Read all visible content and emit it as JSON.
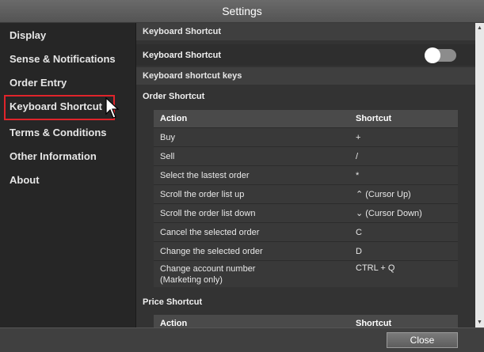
{
  "window": {
    "title": "Settings"
  },
  "sidebar": {
    "items": [
      {
        "label": "Display"
      },
      {
        "label": "Sense & Notifications"
      },
      {
        "label": "Order Entry"
      },
      {
        "label": "Keyboard Shortcut",
        "selected": true
      },
      {
        "label": "Terms & Conditions"
      },
      {
        "label": "Other Information"
      },
      {
        "label": "About"
      }
    ]
  },
  "content": {
    "section_header": "Keyboard Shortcut",
    "toggle_label": "Keyboard Shortcut",
    "toggle_state": "on",
    "keys_header": "Keyboard shortcut keys",
    "order_title": "Order Shortcut",
    "order_table": {
      "headers": [
        "Action",
        "Shortcut"
      ],
      "rows": [
        [
          "Buy",
          "+"
        ],
        [
          "Sell",
          "/"
        ],
        [
          "Select the lastest order",
          "*"
        ],
        [
          "Scroll the order list up",
          "⌃ (Cursor Up)"
        ],
        [
          "Scroll the order list down",
          "⌄ (Cursor Down)"
        ],
        [
          "Cancel the selected order",
          "C"
        ],
        [
          "Change the selected order",
          "D"
        ],
        [
          "Change account number\n(Marketing only)",
          "CTRL + Q"
        ]
      ]
    },
    "price_title": "Price Shortcut",
    "price_table": {
      "headers": [
        "Action",
        "Shortcut"
      ]
    }
  },
  "footer": {
    "close_label": "Close"
  },
  "colors": {
    "highlight": "#e0242b",
    "background": "#333333",
    "sidebar": "#262626"
  }
}
